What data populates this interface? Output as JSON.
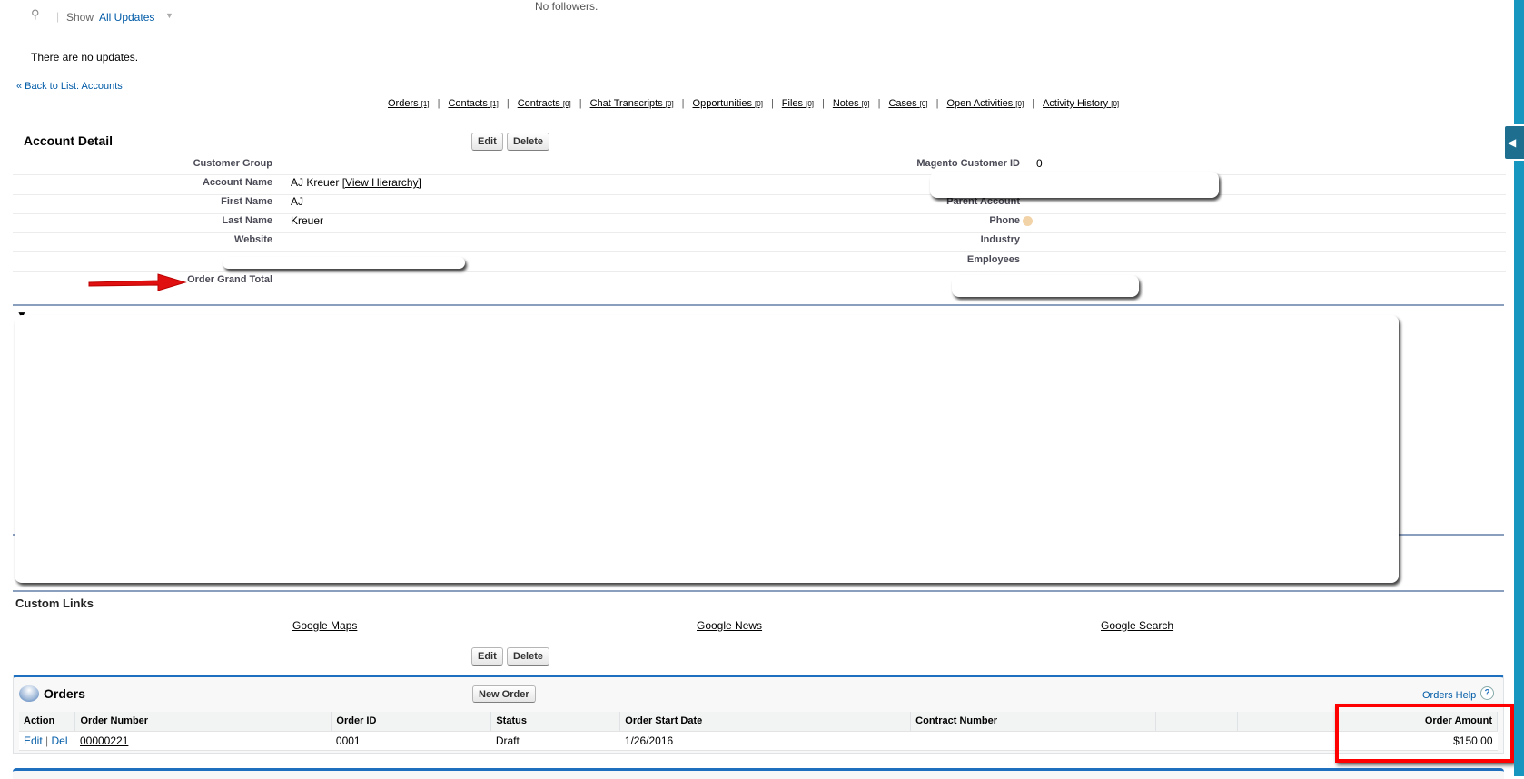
{
  "feed": {
    "search_icon": "search-icon",
    "show_label": "Show",
    "filter_value": "All Updates",
    "no_updates": "There are no updates.",
    "no_followers": "No followers."
  },
  "back_link": "« Back to List: Accounts",
  "related_links": [
    {
      "label": "Orders",
      "count": "[1]"
    },
    {
      "label": "Contacts",
      "count": "[1]"
    },
    {
      "label": "Contracts",
      "count": "[0]"
    },
    {
      "label": "Chat Transcripts",
      "count": "[0]"
    },
    {
      "label": "Opportunities",
      "count": "[0]"
    },
    {
      "label": "Files",
      "count": "[0]"
    },
    {
      "label": "Notes",
      "count": "[0]"
    },
    {
      "label": "Cases",
      "count": "[0]"
    },
    {
      "label": "Open Activities",
      "count": "[0]"
    },
    {
      "label": "Activity History",
      "count": "[0]"
    }
  ],
  "detail": {
    "title": "Account Detail",
    "edit": "Edit",
    "delete": "Delete",
    "left": [
      {
        "label": "Customer Group",
        "value": ""
      },
      {
        "label": "Account Name",
        "value": "AJ Kreuer",
        "link": "[View Hierarchy]"
      },
      {
        "label": "First Name",
        "value": "AJ"
      },
      {
        "label": "Last Name",
        "value": "Kreuer"
      },
      {
        "label": "Website",
        "value": ""
      },
      {
        "label": "Order Grand Total",
        "value": ""
      }
    ],
    "right": [
      {
        "label": "Magento Customer ID",
        "value": "0"
      },
      {
        "label": "Parent Account",
        "value": ""
      },
      {
        "label": "Phone",
        "value": ""
      },
      {
        "label": "Industry",
        "value": ""
      },
      {
        "label": "Employees",
        "value": ""
      }
    ]
  },
  "custom_links": {
    "title": "Custom Links",
    "links": [
      "Google Maps",
      "Google News",
      "Google Search"
    ],
    "edit": "Edit",
    "delete": "Delete"
  },
  "orders": {
    "title": "Orders",
    "new_button": "New Order",
    "help": "Orders Help",
    "columns": [
      "Action",
      "Order Number",
      "Order ID",
      "Status",
      "Order Start Date",
      "Contract Number",
      "",
      "Order Amount"
    ],
    "rows": [
      {
        "edit": "Edit",
        "del": "Del",
        "order_number": "00000221",
        "order_id": "0001",
        "status": "Draft",
        "start_date": "1/26/2016",
        "contract_number": "",
        "amount": "$150.00"
      }
    ]
  },
  "colors": {
    "accent": "#1797c0",
    "section_line": "#8a9ebe",
    "related_list_border": "#1f6fbf",
    "highlight": "#ff0000"
  }
}
